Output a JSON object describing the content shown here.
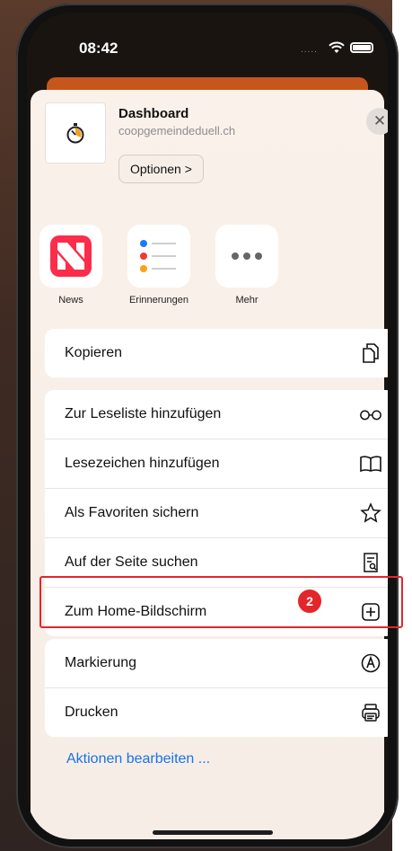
{
  "status": {
    "time": "08:42",
    "signal_dots": "....."
  },
  "share_header": {
    "title": "Dashboard",
    "url": "coopgemeindeduell.ch",
    "options_label": "Optionen >",
    "close_label": "✕",
    "thumbnail_icon": "stopwatch-icon"
  },
  "apps": [
    {
      "label": "News",
      "icon": "news-app-icon"
    },
    {
      "label": "Erinnerungen",
      "icon": "reminders-app-icon"
    },
    {
      "label": "Mehr",
      "icon": "more-apps-icon"
    }
  ],
  "actions": {
    "group1": [
      {
        "label": "Kopieren",
        "icon": "copy-icon"
      }
    ],
    "group2": [
      {
        "label": "Zur Leseliste hinzufügen",
        "icon": "glasses-icon"
      },
      {
        "label": "Lesezeichen hinzufügen",
        "icon": "book-icon"
      },
      {
        "label": "Als Favoriten sichern",
        "icon": "star-icon"
      },
      {
        "label": "Auf der Seite suchen",
        "icon": "find-on-page-icon"
      },
      {
        "label": "Zum Home-Bildschirm",
        "icon": "add-square-icon"
      }
    ],
    "group3": [
      {
        "label": "Markierung",
        "icon": "markup-icon"
      },
      {
        "label": "Drucken",
        "icon": "printer-icon"
      }
    ]
  },
  "step_badge": "2",
  "edit_actions_label": "Aktionen bearbeiten ...",
  "colors": {
    "highlight": "#e3262b",
    "link": "#1a73e8",
    "browser_bar": "#c7561c"
  }
}
